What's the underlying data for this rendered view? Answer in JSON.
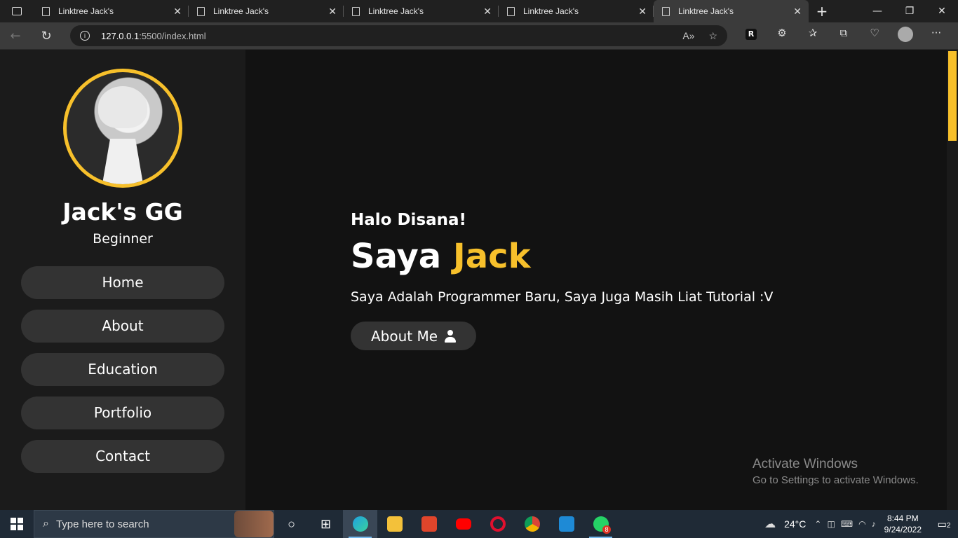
{
  "browser": {
    "tabs": [
      {
        "title": "Linktree Jack's"
      },
      {
        "title": "Linktree Jack's"
      },
      {
        "title": "Linktree Jack's"
      },
      {
        "title": "Linktree Jack's"
      },
      {
        "title": "Linktree Jack's"
      }
    ],
    "url_host": "127.0.0.1",
    "url_path": ":5500/index.html"
  },
  "profile": {
    "name": "Jack's GG",
    "role": "Beginner"
  },
  "menu": [
    "Home",
    "About",
    "Education",
    "Portfolio",
    "Contact"
  ],
  "hero": {
    "greeting": "Halo Disana!",
    "headline_prefix": "Saya ",
    "headline_accent": "Jack",
    "description": "Saya Adalah Programmer Baru, Saya Juga Masih Liat Tutorial :V",
    "button_label": "About Me"
  },
  "watermark": {
    "title": "Activate Windows",
    "subtitle": "Go to Settings to activate Windows."
  },
  "taskbar": {
    "search_placeholder": "Type here to search",
    "temperature": "24°C",
    "time": "8:44 PM",
    "date": "9/24/2022",
    "whatsapp_badge": "8",
    "notification_count": "2"
  },
  "colors": {
    "accent": "#f7c02b",
    "sidebar_bg": "#1b1b1b",
    "main_bg": "#121212",
    "button_bg": "#333333"
  }
}
